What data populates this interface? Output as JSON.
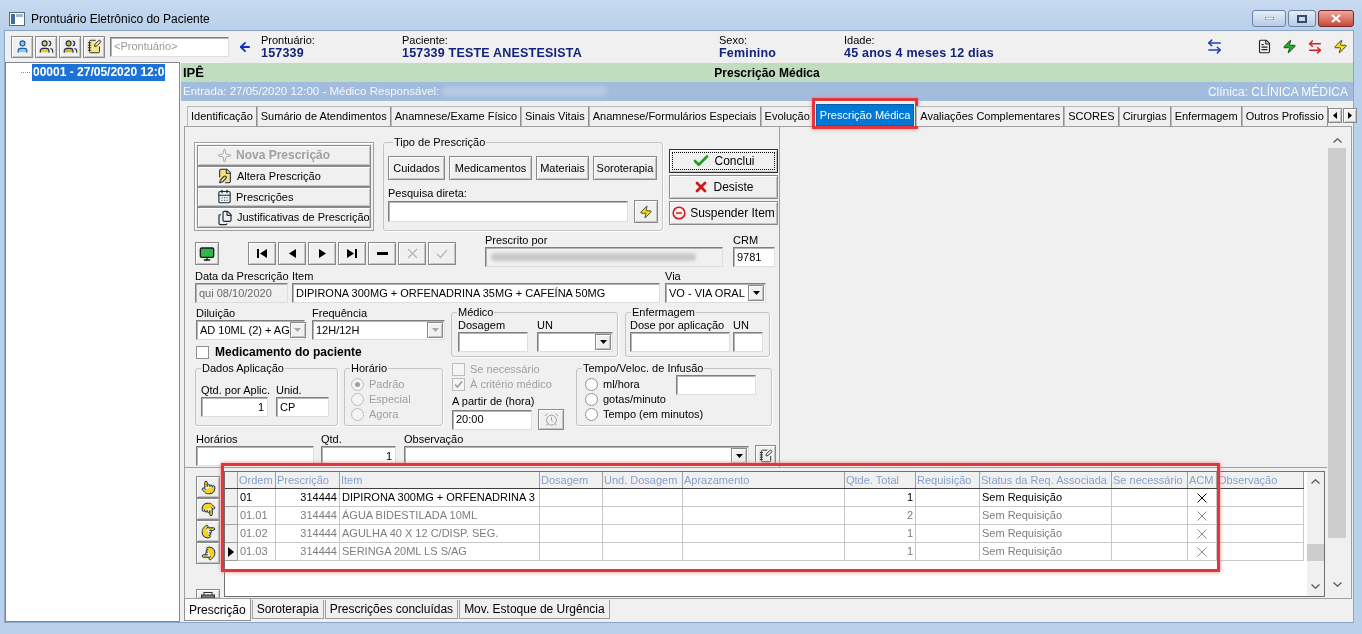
{
  "window": {
    "title": "Prontuário Eletrônico do Paciente"
  },
  "toolbar": {
    "record_field": {
      "placeholder": "<Prontuário>"
    },
    "patient_info": [
      {
        "label": "Prontuário:",
        "value": "157339"
      },
      {
        "label": "Paciente:",
        "value": "157339 TESTE ANESTESISTA"
      },
      {
        "label": "Sexo:",
        "value": "Feminino"
      },
      {
        "label": "Idade:",
        "value": "45 anos 4 meses 12 dias"
      }
    ]
  },
  "sidebar": {
    "items": [
      {
        "label": "00001 - 27/05/2020 12:0",
        "selected": true
      }
    ]
  },
  "header": {
    "unit": "IPÊ",
    "title": "Prescrição Médica",
    "entry": "Entrada: 27/05/2020 12:00 - Médico Responsável:",
    "clinic": "Clínica: CLÍNICA MÉDICA"
  },
  "tabs": [
    {
      "label": "Identificação",
      "selected": false
    },
    {
      "label": "Sumário de Atendimentos",
      "selected": false
    },
    {
      "label": "Anamnese/Exame Físico",
      "selected": false
    },
    {
      "label": "Sinais Vitais",
      "selected": false
    },
    {
      "label": "Anamnese/Formulários Especiais",
      "selected": false
    },
    {
      "label": "Evolução",
      "selected": false
    },
    {
      "label": "Prescrição Médica",
      "selected": true
    },
    {
      "label": "Avaliações Complementares",
      "selected": false
    },
    {
      "label": "SCORES",
      "selected": false
    },
    {
      "label": "Cirurgias",
      "selected": false
    },
    {
      "label": "Enfermagem",
      "selected": false
    },
    {
      "label": "Outros Profissio",
      "selected": false
    }
  ],
  "form": {
    "actions": [
      {
        "label": "Nova Prescrição",
        "disabled": true
      },
      {
        "label": "Altera Prescrição",
        "disabled": false
      },
      {
        "label": "Prescrições",
        "disabled": false
      },
      {
        "label": "Justificativas de Prescrição",
        "disabled": false
      }
    ],
    "prescription_type": {
      "title": "Tipo de Prescrição",
      "buttons": [
        "Cuidados",
        "Medicamentos",
        "Materiais",
        "Soroterapia"
      ],
      "search_label": "Pesquisa direta:"
    },
    "commands": [
      {
        "kind": "confirm",
        "label": "Conclui"
      },
      {
        "kind": "cancel",
        "label": "Desiste"
      },
      {
        "kind": "suspend",
        "label": "Suspender Item"
      }
    ],
    "navigator": [
      {
        "kind": "first",
        "disabled": false
      },
      {
        "kind": "prior",
        "disabled": false
      },
      {
        "kind": "next",
        "disabled": false
      },
      {
        "kind": "last",
        "disabled": false
      },
      {
        "kind": "delete",
        "disabled": false
      },
      {
        "kind": "cancel",
        "disabled": true
      },
      {
        "kind": "post",
        "disabled": true
      }
    ],
    "prescribed_by": {
      "label": "Prescrito por"
    },
    "crm": {
      "label": "CRM",
      "value": "9781"
    },
    "date": {
      "label": "Data da Prescrição",
      "value": "qui 08/10/2020",
      "disabled": true
    },
    "item": {
      "label": "Item",
      "value": "DIPIRONA 300MG + ORFENADRINA 35MG + CAFEÍNA 50MG"
    },
    "route": {
      "label": "Via",
      "value": "VO - VIA ORAL"
    },
    "dilution": {
      "label": "Diluição",
      "value": "AD 10ML (2) + AG",
      "disabled": true
    },
    "frequency": {
      "label": "Frequência",
      "value": "12H/12H",
      "disabled": true
    },
    "patient_medication": {
      "label": "Medicamento do paciente",
      "checked": false
    },
    "doctor": {
      "title": "Médico",
      "dose_label": "Dosagem",
      "unit_label": "UN"
    },
    "nursing": {
      "title": "Enfermagem",
      "dose_label": "Dose por aplicação",
      "unit_label": "UN"
    },
    "application": {
      "title": "Dados Aplicação",
      "quantity_label": "Qtd. por Aplic.",
      "quantity": "1",
      "unit_label": "Unid.",
      "unit": "CP"
    },
    "schedule": {
      "title": "Horário",
      "disabled": true,
      "options": [
        {
          "label": "Padrão",
          "selected": true
        },
        {
          "label": "Especial",
          "selected": false
        },
        {
          "label": "Agora",
          "selected": false
        }
      ]
    },
    "flags": [
      {
        "label": "Se necessário",
        "checked": false,
        "disabled": true
      },
      {
        "label": "À critério médico",
        "checked": true,
        "disabled": true
      }
    ],
    "start_time": {
      "label": "A partir de (hora)",
      "value": "20:00"
    },
    "infusion": {
      "title": "Tempo/Veloc. de Infusão",
      "options": [
        {
          "label": "ml/hora",
          "selected": false
        },
        {
          "label": "gotas/minuto",
          "selected": false
        },
        {
          "label": "Tempo (em minutos)",
          "selected": false
        }
      ]
    },
    "times": {
      "label": "Horários"
    },
    "quantity": {
      "label": "Qtd.",
      "value": "1"
    },
    "notes": {
      "label": "Observação"
    }
  },
  "grid": {
    "columns": [
      "Ordem",
      "Prescrição",
      "Item",
      "Dosagem",
      "Und. Dosagem",
      "Aprazamento",
      "Qtde. Total",
      "Requisição",
      "Status da Req. Associada",
      "Se necessário",
      "ACM",
      "Observação"
    ],
    "rows": [
      {
        "kind": "medication",
        "selected": false,
        "order": "01",
        "prescription": "314444",
        "item": "DIPIRONA 300MG + ORFENADRINA 3",
        "total_qty": "1",
        "status": "Sem Requisição",
        "acm": true
      },
      {
        "kind": "component",
        "selected": false,
        "order": "01.01",
        "prescription": "314444",
        "item": "ÁGUA BIDESTILADA 10ML",
        "total_qty": "2",
        "status": "Sem Requisição",
        "acm": true
      },
      {
        "kind": "component",
        "selected": false,
        "order": "01.02",
        "prescription": "314444",
        "item": "AGULHA 40 X 12 C/DISP. SEG.",
        "total_qty": "1",
        "status": "Sem Requisição",
        "acm": true
      },
      {
        "kind": "component",
        "selected": true,
        "order": "01.03",
        "prescription": "314444",
        "item": "SERINGA 20ML LS S/AG",
        "total_qty": "1",
        "status": "Sem Requisição",
        "acm": true
      }
    ]
  },
  "bottom_tabs": [
    {
      "label": "Prescrição",
      "selected": true
    },
    {
      "label": "Soroterapia",
      "selected": false
    },
    {
      "label": "Prescrições concluídas",
      "selected": false
    },
    {
      "label": "Mov. Estoque de Urgência",
      "selected": false
    }
  ]
}
